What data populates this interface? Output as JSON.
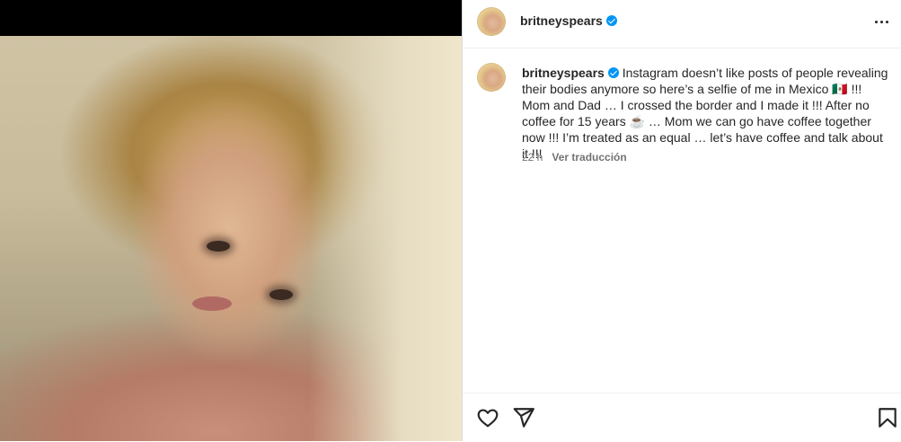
{
  "post": {
    "username": "britneyspears",
    "verified": true,
    "caption": "Instagram doesn’t like posts of people revealing their bodies anymore so here’s a selfie of me in Mexico 🇲🇽 !!! Mom and Dad … I crossed the border and I made it !!! After no coffee for 15 years ☕ … Mom we can go have coffee together now !!! I’m treated as an equal … let’s have coffee and talk about it !!!",
    "time_ago": "22 h",
    "translate_label": "Ver traducción"
  },
  "icons": {
    "more": "more-options-icon",
    "like": "heart-icon",
    "share": "send-icon",
    "save": "bookmark-icon",
    "verified": "verified-badge-icon"
  },
  "colors": {
    "verified_blue": "#0095f6",
    "text": "#262626",
    "secondary_text": "#737373"
  }
}
